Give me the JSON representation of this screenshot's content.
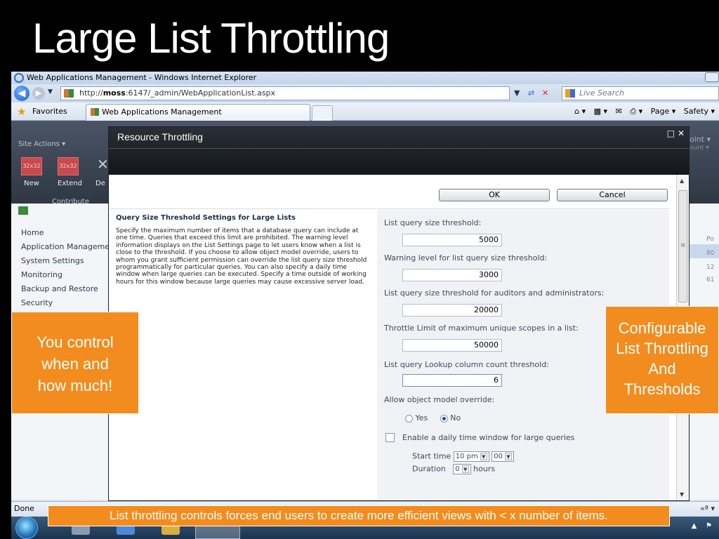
{
  "slide": {
    "title": "Large List Throttling"
  },
  "browser": {
    "window_title": "Web Applications Management - Windows Internet Explorer",
    "url_prefix": "http://",
    "url_host": "moss",
    "url_rest": ":6147/_admin/WebApplicationList.aspx",
    "search_placeholder": "Live Search",
    "favorites_label": "Favorites",
    "tab_label": "Web Applications Management",
    "page_label": "Page ▾",
    "safety_label": "Safety ▾",
    "status_text": "Done",
    "zoom_label": "«ª ▾"
  },
  "sharepoint": {
    "site_actions": "Site Actions ▾",
    "ribbon": {
      "icon_text": "32x32",
      "new_label": "New",
      "extend_label": "Extend",
      "de_label": "De",
      "group_label": "Contribute"
    },
    "left_nav": [
      "Home",
      "Application Management",
      "System Settings",
      "Monitoring",
      "Backup and Restore",
      "Security"
    ],
    "right_strip": {
      "top": "oint ▾",
      "top2": "ount ▾",
      "col_header": "Po",
      "rows": [
        "80",
        "12",
        "61"
      ]
    }
  },
  "dialog": {
    "title": "Resource Throttling",
    "ok_label": "OK",
    "cancel_label": "Cancel",
    "section_title": "Query Size Threshold Settings for Large Lists",
    "section_desc": "Specify the maximum number of items that a database query can include at one time. Queries that exceed this limit are prohibited. The warning level information displays on the List Settings page to let users know when a list is close to the threshold. If you choose to allow object model override, users to whom you grant sufficient permission can override the list query size threshold programmatically for particular queries. You can also specify a daily time window when large queries can be executed. Specify a time outside of working hours for this window because large queries may cause excessive server load.",
    "fields": [
      {
        "label": "List query size threshold:",
        "value": "5000"
      },
      {
        "label": "Warning level for list query size threshold:",
        "value": "3000"
      },
      {
        "label": "List query size threshold for auditors and administrators:",
        "value": "20000"
      },
      {
        "label": "Throttle Limit of maximum unique scopes in a list:",
        "value": "50000"
      },
      {
        "label": "List query Lookup column count threshold:",
        "value": "6"
      }
    ],
    "override_label": "Allow object model override:",
    "override_yes": "Yes",
    "override_no": "No",
    "override_selected": "No",
    "time_window_label": "Enable a daily time window for large queries",
    "start_time_label": "Start time",
    "start_hour": "10 pm",
    "start_minute": "00",
    "duration_label": "Duration",
    "duration_value": "0",
    "hours_label": "hours"
  },
  "callouts": {
    "left": [
      "You control",
      "when and",
      "how much!"
    ],
    "right": [
      "Configurable",
      "List Throttling",
      "And",
      "Thresholds"
    ],
    "bottom": "List throttling controls forces end users to create more efficient views with < x number of items."
  },
  "colors": {
    "callout_orange": "#f28c1e",
    "dialog_header": "#1e2228",
    "settings_panel": "#f0f2f5"
  }
}
